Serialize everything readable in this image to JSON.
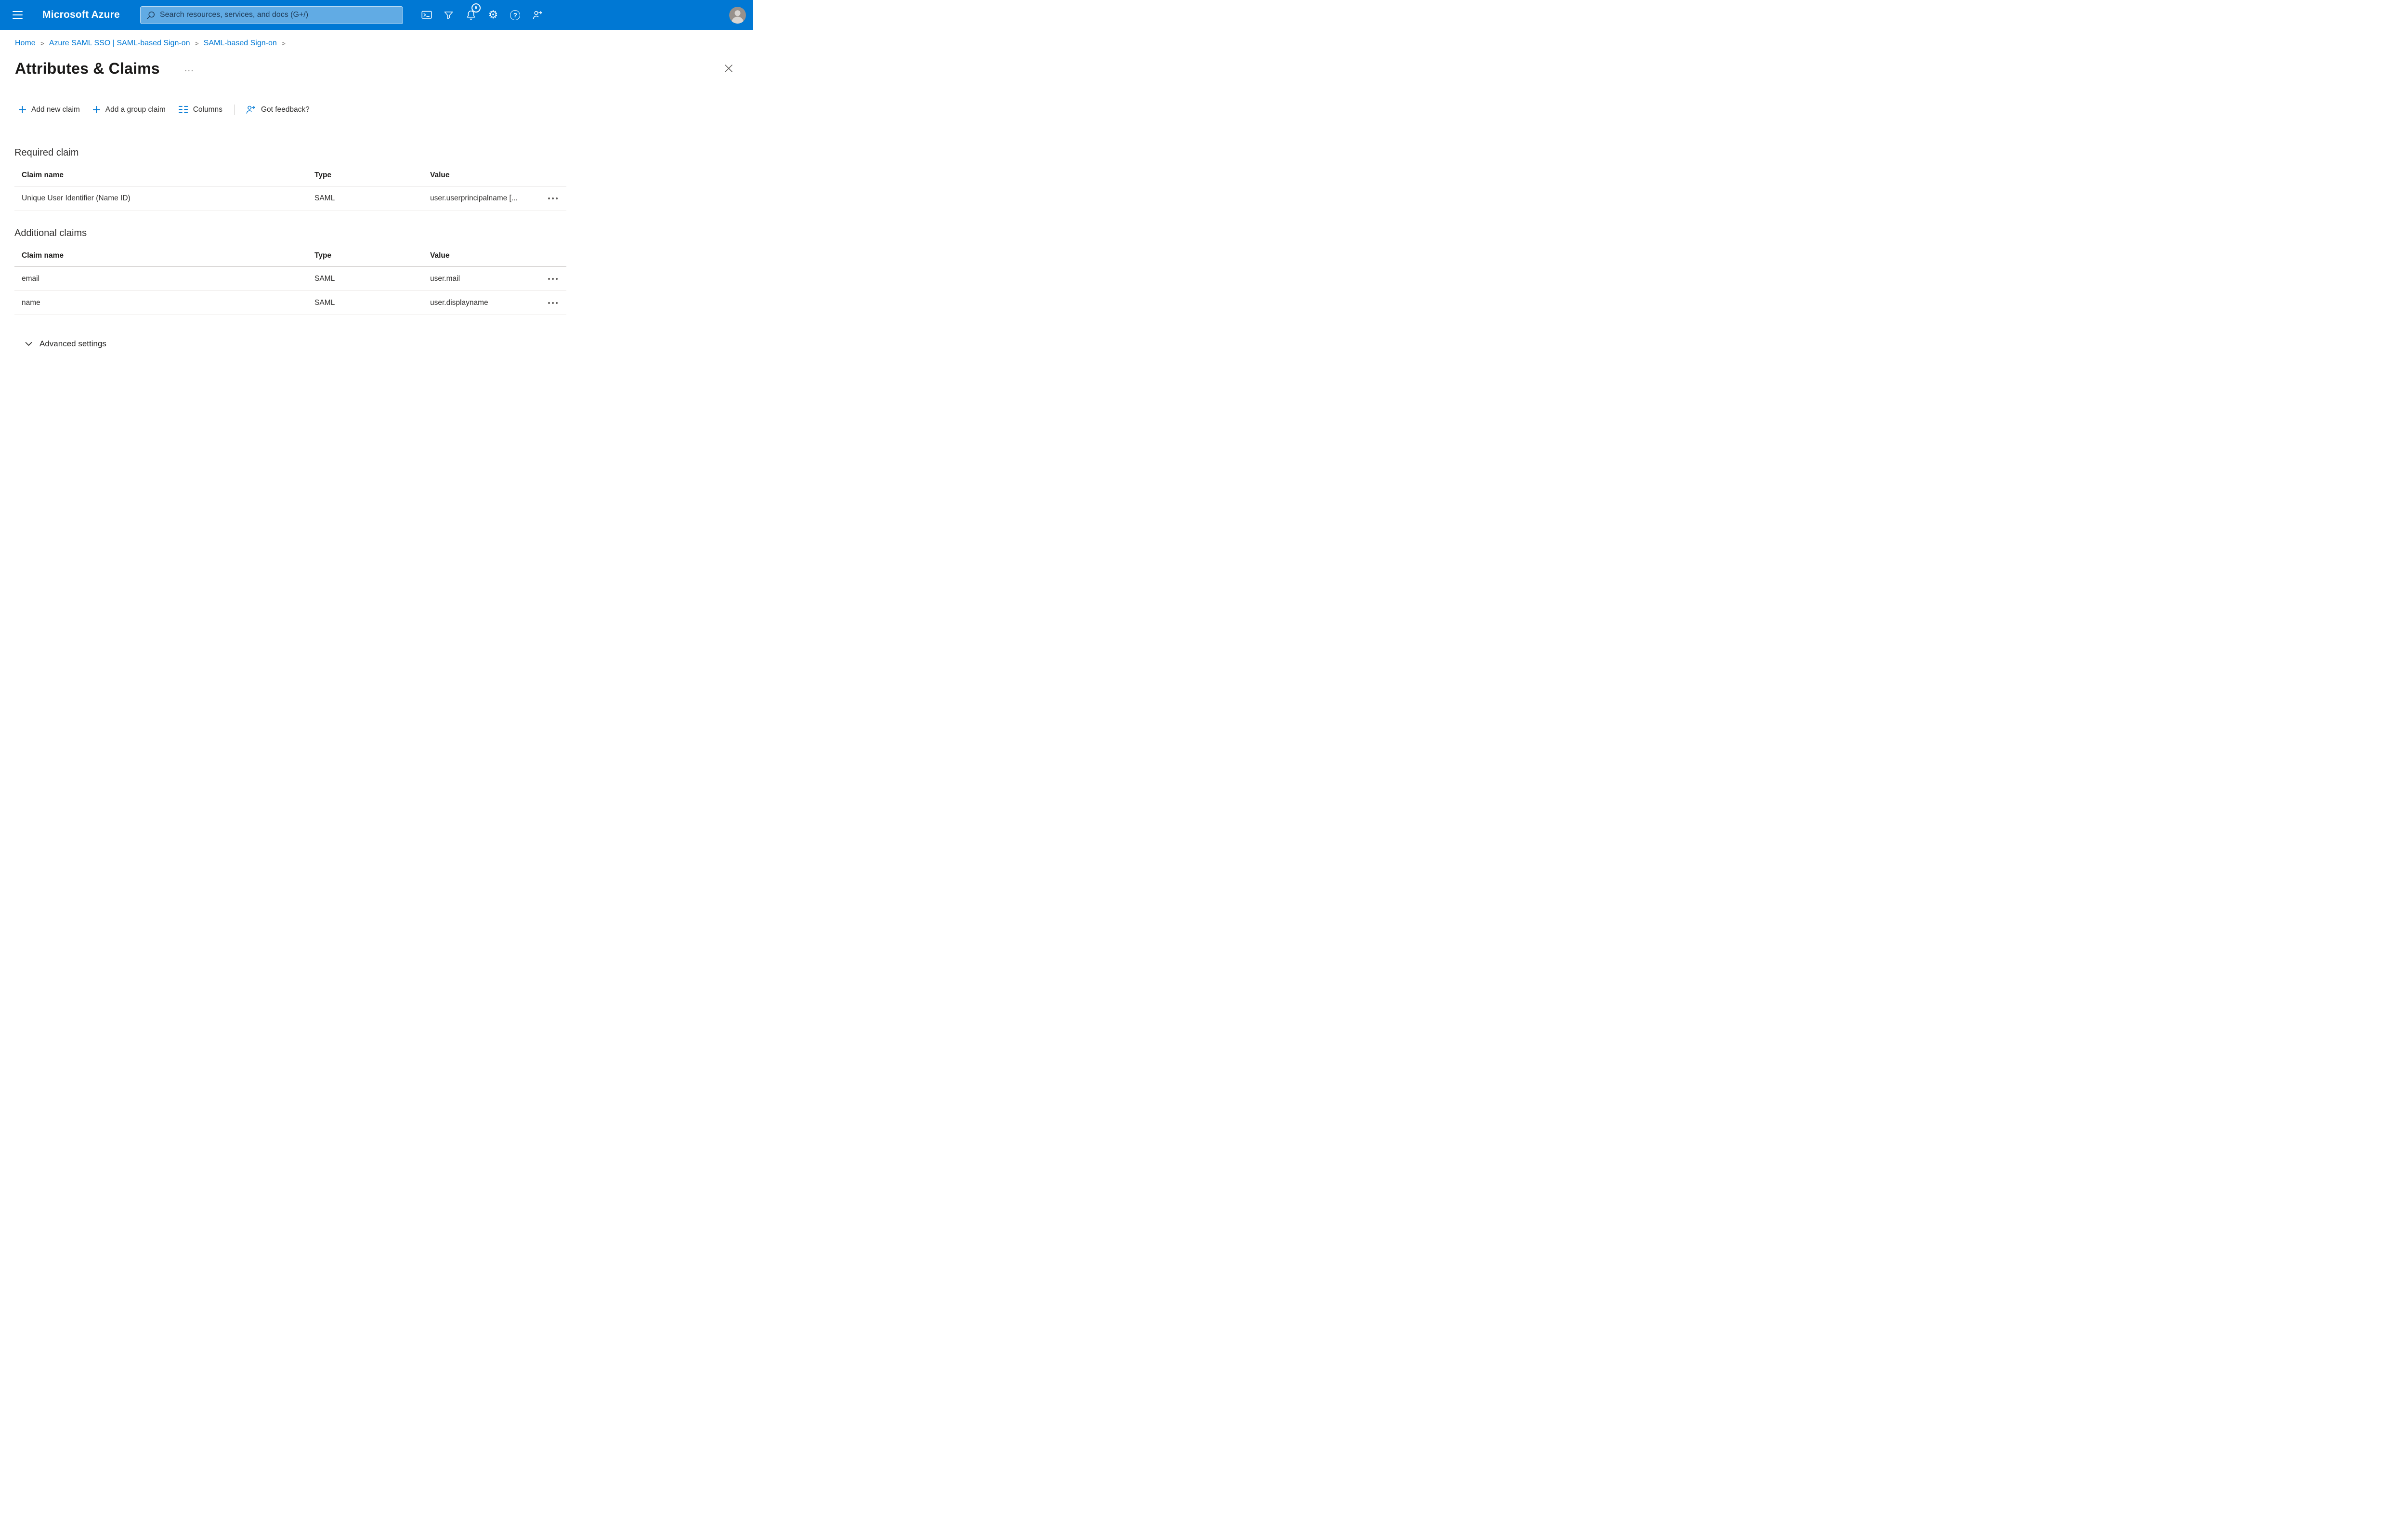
{
  "colors": {
    "topbar": "#0078d4",
    "accent": "#0078d4",
    "link": "#0078d4",
    "text": "#323130",
    "divider": "#edebe9"
  },
  "topbar": {
    "brand": "Microsoft Azure",
    "search_placeholder": "Search resources, services, and docs (G+/)",
    "notification_count": "6"
  },
  "icons": {
    "hamburger": "menu-bars",
    "search": "magnifier",
    "cloud_shell": "terminal",
    "directory_filter": "funnel",
    "notifications": "bell",
    "settings": "⚙",
    "help": "?",
    "feedback": "person-arrow",
    "avatar": "person-silhouette",
    "add": "plus",
    "columns": "double-line-list",
    "row_menu": "ellipsis-dots",
    "close": "x",
    "advanced_chevron": "chevron-down"
  },
  "breadcrumb": {
    "separator": ">",
    "items": [
      {
        "label": "Home"
      },
      {
        "label": "Azure SAML SSO | SAML-based Sign-on"
      },
      {
        "label": "SAML-based Sign-on"
      }
    ]
  },
  "page": {
    "title": "Attributes & Claims",
    "more_label": "…"
  },
  "toolbar": {
    "add_new_claim": "Add new claim",
    "add_group_claim": "Add a group claim",
    "columns": "Columns",
    "got_feedback": "Got feedback?"
  },
  "required_claim": {
    "heading": "Required claim",
    "columns": {
      "claim_name": "Claim name",
      "type": "Type",
      "value": "Value"
    },
    "rows": [
      {
        "claim_name": "Unique User Identifier (Name ID)",
        "type": "SAML",
        "value": "user.userprincipalname [..."
      }
    ]
  },
  "additional_claims": {
    "heading": "Additional claims",
    "columns": {
      "claim_name": "Claim name",
      "type": "Type",
      "value": "Value"
    },
    "rows": [
      {
        "claim_name": "email",
        "type": "SAML",
        "value": "user.mail"
      },
      {
        "claim_name": "name",
        "type": "SAML",
        "value": "user.displayname"
      }
    ]
  },
  "advanced": {
    "label": "Advanced settings"
  }
}
